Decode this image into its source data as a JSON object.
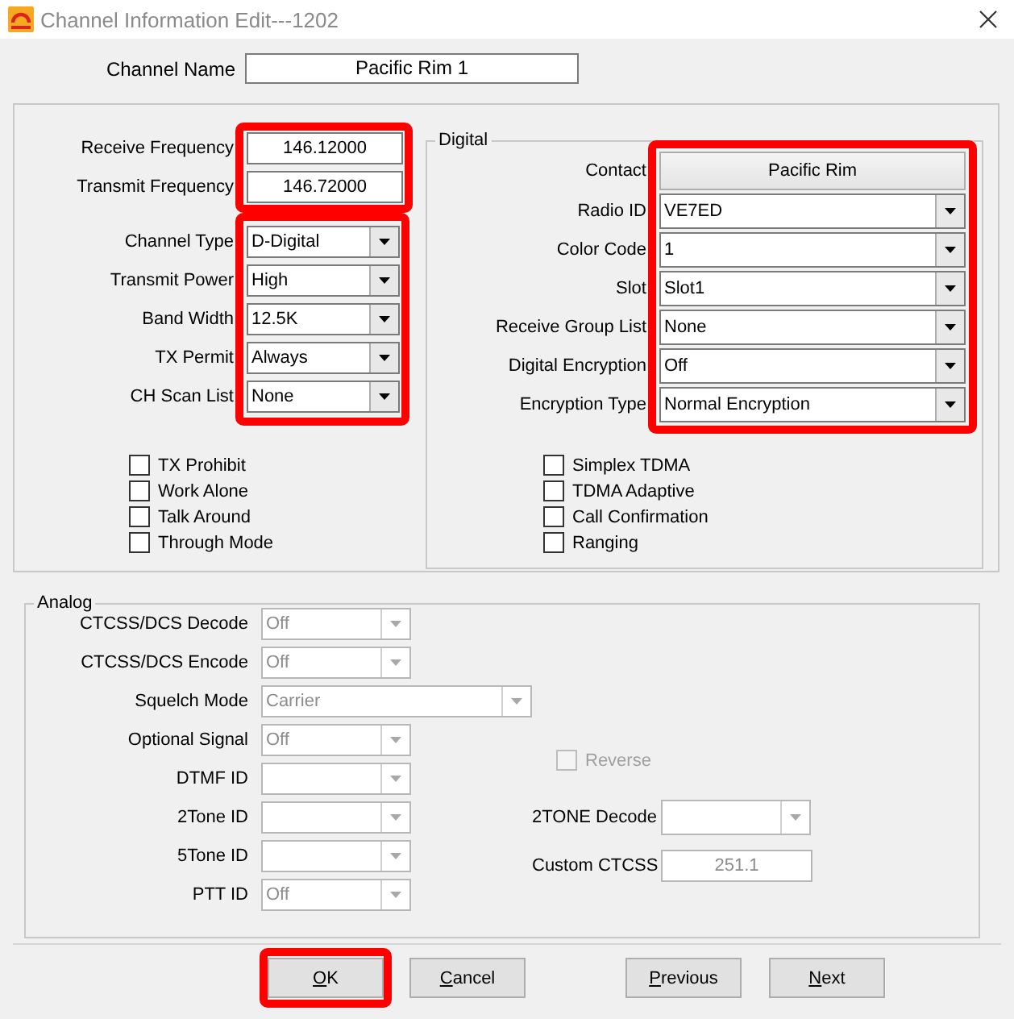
{
  "window": {
    "title": "Channel Information Edit---1202"
  },
  "channel_name": {
    "label": "Channel Name",
    "value": "Pacific Rim 1"
  },
  "frequencies": {
    "highlighted": true,
    "fields": [
      {
        "kind": "text",
        "label": "Receive Frequency",
        "value": "146.12000"
      },
      {
        "kind": "text",
        "label": "Transmit Frequency",
        "value": "146.72000"
      }
    ]
  },
  "basic": {
    "highlighted": true,
    "fields": [
      {
        "kind": "combo",
        "label": "Channel Type",
        "value": "D-Digital"
      },
      {
        "kind": "combo",
        "label": "Transmit Power",
        "value": "High"
      },
      {
        "kind": "combo",
        "label": "Band Width",
        "value": "12.5K"
      },
      {
        "kind": "combo",
        "label": "TX Permit",
        "value": "Always"
      },
      {
        "kind": "combo",
        "label": "CH Scan List",
        "value": "None"
      }
    ]
  },
  "options": [
    {
      "label": "TX Prohibit",
      "checked": false
    },
    {
      "label": "Work Alone",
      "checked": false
    },
    {
      "label": "Talk Around",
      "checked": false
    },
    {
      "label": "Through Mode",
      "checked": false
    }
  ],
  "digital": {
    "title": "Digital",
    "highlighted": true,
    "fields": [
      {
        "kind": "button",
        "label": "Contact",
        "value": "Pacific Rim"
      },
      {
        "kind": "combo",
        "label": "Radio ID",
        "value": "VE7ED"
      },
      {
        "kind": "combo",
        "label": "Color Code",
        "value": "1"
      },
      {
        "kind": "combo",
        "label": "Slot",
        "value": "Slot1"
      },
      {
        "kind": "combo",
        "label": "Receive Group List",
        "value": "None"
      },
      {
        "kind": "combo",
        "label": "Digital Encryption",
        "value": "Off"
      },
      {
        "kind": "combo",
        "label": "Encryption Type",
        "value": "Normal Encryption"
      }
    ],
    "options": [
      {
        "label": "Simplex TDMA",
        "checked": false
      },
      {
        "label": "TDMA Adaptive",
        "checked": false
      },
      {
        "label": "Call Confirmation",
        "checked": false
      },
      {
        "label": "Ranging",
        "checked": false
      }
    ]
  },
  "analog": {
    "title": "Analog",
    "fields": [
      {
        "kind": "combo",
        "label": "CTCSS/DCS Decode",
        "value": "Off",
        "disabled": true
      },
      {
        "kind": "combo",
        "label": "CTCSS/DCS Encode",
        "value": "Off",
        "disabled": true
      },
      {
        "kind": "wide-combo",
        "label": "Squelch Mode",
        "value": "Carrier",
        "disabled": true
      },
      {
        "kind": "combo",
        "label": "Optional Signal",
        "value": "Off",
        "disabled": true
      },
      {
        "kind": "combo",
        "label": "DTMF ID",
        "disabled": true
      },
      {
        "kind": "combo",
        "label": "2Tone ID",
        "disabled": true
      },
      {
        "kind": "combo",
        "label": "5Tone ID",
        "disabled": true
      },
      {
        "kind": "combo",
        "label": "PTT ID",
        "value": "Off",
        "disabled": true
      }
    ],
    "reverse": {
      "label": "Reverse",
      "checked": false,
      "disabled": true
    },
    "right_fields": [
      {
        "kind": "combo",
        "label": "2TONE Decode",
        "disabled": true
      },
      {
        "kind": "text",
        "label": "Custom CTCSS",
        "value": "251.1",
        "disabled": true
      }
    ]
  },
  "buttons": [
    {
      "label": "OK",
      "highlighted": true
    },
    {
      "label": "Cancel",
      "highlighted": false
    },
    {
      "label": "Previous",
      "highlighted": false
    },
    {
      "label": "Next",
      "highlighted": false
    }
  ]
}
